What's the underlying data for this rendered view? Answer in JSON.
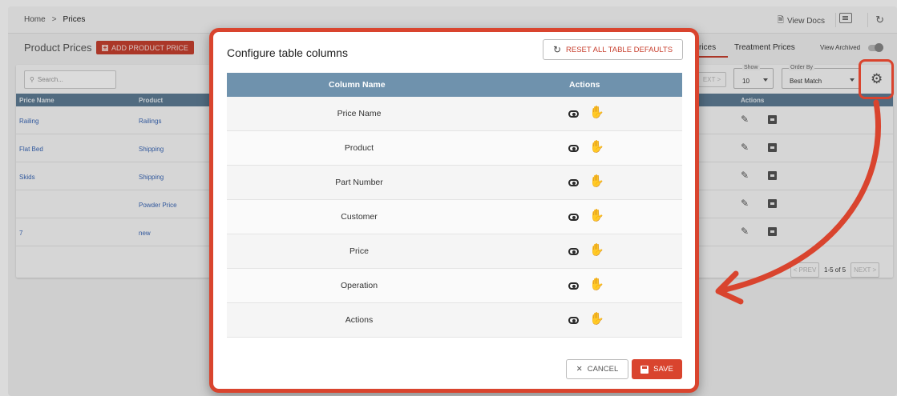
{
  "topbar": {
    "breadcrumb": [
      "Home",
      "Prices"
    ],
    "breadcrumb_sep": ">",
    "view_docs": "View Docs",
    "refresh_icon": "refresh-icon",
    "chat_icon": "chat-icon"
  },
  "page": {
    "title": "Product Prices",
    "add_button": "ADD PRODUCT PRICE",
    "tab_partial": "rices",
    "tab_treatment": "Treatment Prices",
    "view_archived": "View Archived"
  },
  "list": {
    "search_placeholder": "Search...",
    "columns": [
      "Price Name",
      "Product",
      "Actions"
    ],
    "rows": [
      {
        "price_name": "Railing",
        "product": "Railings"
      },
      {
        "price_name": "Flat Bed",
        "product": "Shipping"
      },
      {
        "price_name": "Skids",
        "product": "Shipping"
      },
      {
        "price_name": "",
        "product": "Powder Price"
      },
      {
        "price_name": "7",
        "product": "new"
      }
    ],
    "show_label": "Show",
    "show_value": "10",
    "order_label": "Order By",
    "order_value": "Best Match",
    "next_partial": "EXT >",
    "pager_prev": "< PREV",
    "pager_count": "1-5 of 5",
    "pager_next": "NEXT >"
  },
  "modal": {
    "title": "Configure table columns",
    "reset_button": "RESET ALL TABLE DEFAULTS",
    "header_column_name": "Column Name",
    "header_actions": "Actions",
    "columns": [
      "Price Name",
      "Product",
      "Part Number",
      "Customer",
      "Price",
      "Operation",
      "Actions"
    ],
    "cancel_button": "CANCEL",
    "save_button": "SAVE"
  },
  "colors": {
    "accent": "#d9442e",
    "table_header": "#6f92ad",
    "link": "#3a67b6"
  }
}
